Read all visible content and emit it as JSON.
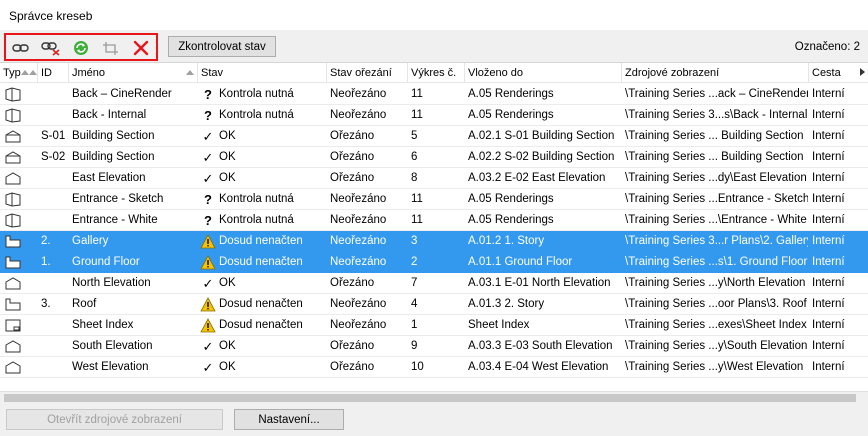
{
  "window": {
    "title": "Správce kreseb"
  },
  "toolbar": {
    "check_label": "Zkontrolovat stav",
    "marked_label": "Označeno: 2",
    "buttons": [
      "link-icon",
      "unlink-icon",
      "refresh-icon",
      "frame-icon",
      "delete-icon"
    ]
  },
  "columns": [
    "Typ",
    "ID",
    "Jméno",
    "Stav",
    "Stav ořezání",
    "Výkres č.",
    "Vloženo do",
    "Zdrojové zobrazení",
    "Cesta"
  ],
  "rows": [
    {
      "icon": "3d-view-icon",
      "id": "",
      "name": "Back – CineRender",
      "status_icon": "question",
      "status": "Kontrola nutná",
      "crop": "Neořezáno",
      "num": "11",
      "placed": "A.05 Renderings",
      "source": "\\Training Series ...ack – CineRender",
      "path": "Interní",
      "selected": false
    },
    {
      "icon": "3d-view-icon",
      "id": "",
      "name": "Back - Internal",
      "status_icon": "question",
      "status": "Kontrola nutná",
      "crop": "Neořezáno",
      "num": "11",
      "placed": "A.05 Renderings",
      "source": "\\Training Series 3...s\\Back - Internal",
      "path": "Interní",
      "selected": false
    },
    {
      "icon": "section-icon",
      "id": "S-01",
      "name": "Building Section",
      "status_icon": "check",
      "status": "OK",
      "crop": "Ořezáno",
      "num": "5",
      "placed": "A.02.1 S-01 Building Section",
      "source": "\\Training Series ... Building Section",
      "path": "Interní",
      "selected": false
    },
    {
      "icon": "section-icon",
      "id": "S-02",
      "name": "Building Section",
      "status_icon": "check",
      "status": "OK",
      "crop": "Ořezáno",
      "num": "6",
      "placed": "A.02.2 S-02 Building Section",
      "source": "\\Training Series ... Building Section",
      "path": "Interní",
      "selected": false
    },
    {
      "icon": "elevation-icon",
      "id": "",
      "name": "East Elevation",
      "status_icon": "check",
      "status": "OK",
      "crop": "Ořezáno",
      "num": "8",
      "placed": "A.03.2 E-02 East Elevation",
      "source": "\\Training Series ...dy\\East Elevation",
      "path": "Interní",
      "selected": false
    },
    {
      "icon": "3d-view-icon",
      "id": "",
      "name": "Entrance - Sketch",
      "status_icon": "question",
      "status": "Kontrola nutná",
      "crop": "Neořezáno",
      "num": "11",
      "placed": "A.05 Renderings",
      "source": "\\Training Series ...Entrance - Sketch",
      "path": "Interní",
      "selected": false
    },
    {
      "icon": "3d-view-icon",
      "id": "",
      "name": "Entrance - White",
      "status_icon": "question",
      "status": "Kontrola nutná",
      "crop": "Neořezáno",
      "num": "11",
      "placed": "A.05 Renderings",
      "source": "\\Training Series ...\\Entrance - White",
      "path": "Interní",
      "selected": false
    },
    {
      "icon": "floor-plan-icon",
      "id": "2.",
      "name": "Gallery",
      "status_icon": "warning",
      "status": "Dosud nenačten",
      "crop": "Neořezáno",
      "num": "3",
      "placed": "A.01.2 1. Story",
      "source": "\\Training Series 3...r Plans\\2. Gallery",
      "path": "Interní",
      "selected": true
    },
    {
      "icon": "floor-plan-icon",
      "id": "1.",
      "name": "Ground Floor",
      "status_icon": "warning",
      "status": "Dosud nenačten",
      "crop": "Neořezáno",
      "num": "2",
      "placed": "A.01.1 Ground Floor",
      "source": "\\Training Series ...s\\1. Ground Floor",
      "path": "Interní",
      "selected": true
    },
    {
      "icon": "elevation-icon",
      "id": "",
      "name": "North Elevation",
      "status_icon": "check",
      "status": "OK",
      "crop": "Ořezáno",
      "num": "7",
      "placed": "A.03.1 E-01 North Elevation",
      "source": "\\Training Series ...y\\North Elevation",
      "path": "Interní",
      "selected": false
    },
    {
      "icon": "floor-plan-icon",
      "id": "3.",
      "name": "Roof",
      "status_icon": "warning",
      "status": "Dosud nenačten",
      "crop": "Neořezáno",
      "num": "4",
      "placed": "A.01.3 2. Story",
      "source": "\\Training Series ...oor Plans\\3. Roof",
      "path": "Interní",
      "selected": false
    },
    {
      "icon": "sheet-index-icon",
      "id": "",
      "name": "Sheet Index",
      "status_icon": "warning",
      "status": "Dosud nenačten",
      "crop": "Neořezáno",
      "num": "1",
      "placed": "Sheet Index",
      "source": "\\Training Series ...exes\\Sheet Index",
      "path": "Interní",
      "selected": false
    },
    {
      "icon": "elevation-icon",
      "id": "",
      "name": "South Elevation",
      "status_icon": "check",
      "status": "OK",
      "crop": "Ořezáno",
      "num": "9",
      "placed": "A.03.3 E-03 South Elevation",
      "source": "\\Training Series ...y\\South Elevation",
      "path": "Interní",
      "selected": false
    },
    {
      "icon": "elevation-icon",
      "id": "",
      "name": "West Elevation",
      "status_icon": "check",
      "status": "OK",
      "crop": "Ořezáno",
      "num": "10",
      "placed": "A.03.4 E-04 West Elevation",
      "source": "\\Training Series ...y\\West Elevation",
      "path": "Interní",
      "selected": false
    }
  ],
  "footer": {
    "open_source_label": "Otevřít zdrojové zobrazení",
    "settings_label": "Nastavení..."
  },
  "colors": {
    "selection": "#3399ee",
    "highlight_frame": "#e8161b",
    "warning": "#f5c400"
  }
}
